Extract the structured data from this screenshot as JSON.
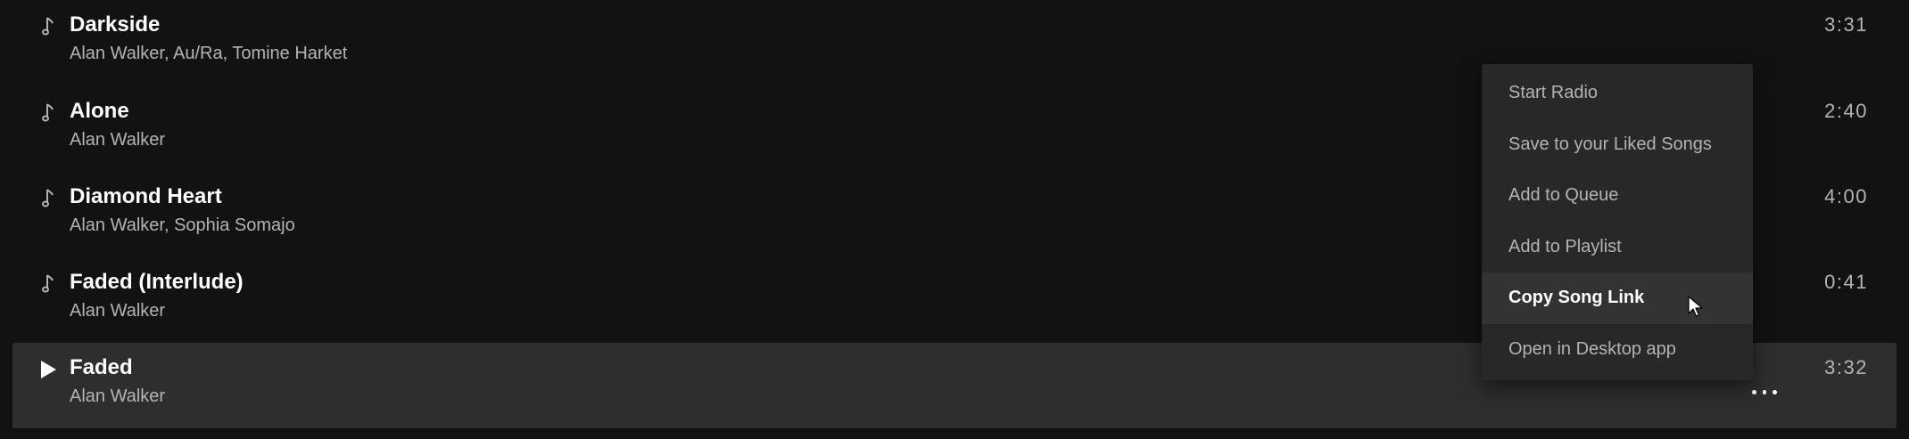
{
  "tracks": [
    {
      "title": "Darkside",
      "artists": "Alan Walker, Au/Ra, Tomine Harket",
      "duration": "3:31",
      "icon": "music-note-icon"
    },
    {
      "title": "Alone",
      "artists": "Alan Walker",
      "duration": "2:40",
      "icon": "music-note-icon"
    },
    {
      "title": "Diamond Heart",
      "artists": "Alan Walker, Sophia Somajo",
      "duration": "4:00",
      "icon": "music-note-icon"
    },
    {
      "title": "Faded (Interlude)",
      "artists": "Alan Walker",
      "duration": "0:41",
      "icon": "music-note-icon"
    },
    {
      "title": "Faded",
      "artists": "Alan Walker",
      "duration": "3:32",
      "icon": "play-icon"
    }
  ],
  "context_menu": {
    "items": [
      {
        "label": "Start Radio"
      },
      {
        "label": "Save to your Liked Songs"
      },
      {
        "label": "Add to Queue"
      },
      {
        "label": "Add to Playlist"
      },
      {
        "label": "Copy Song Link"
      },
      {
        "label": "Open in Desktop app"
      }
    ],
    "hovered_item": "Copy Song Link"
  },
  "colors": {
    "background": "#121212",
    "row_active": "#2e2e2e",
    "menu_bg": "#282828",
    "menu_hover": "#333333",
    "text_primary": "#ffffff",
    "text_secondary": "#b3b3b3"
  }
}
